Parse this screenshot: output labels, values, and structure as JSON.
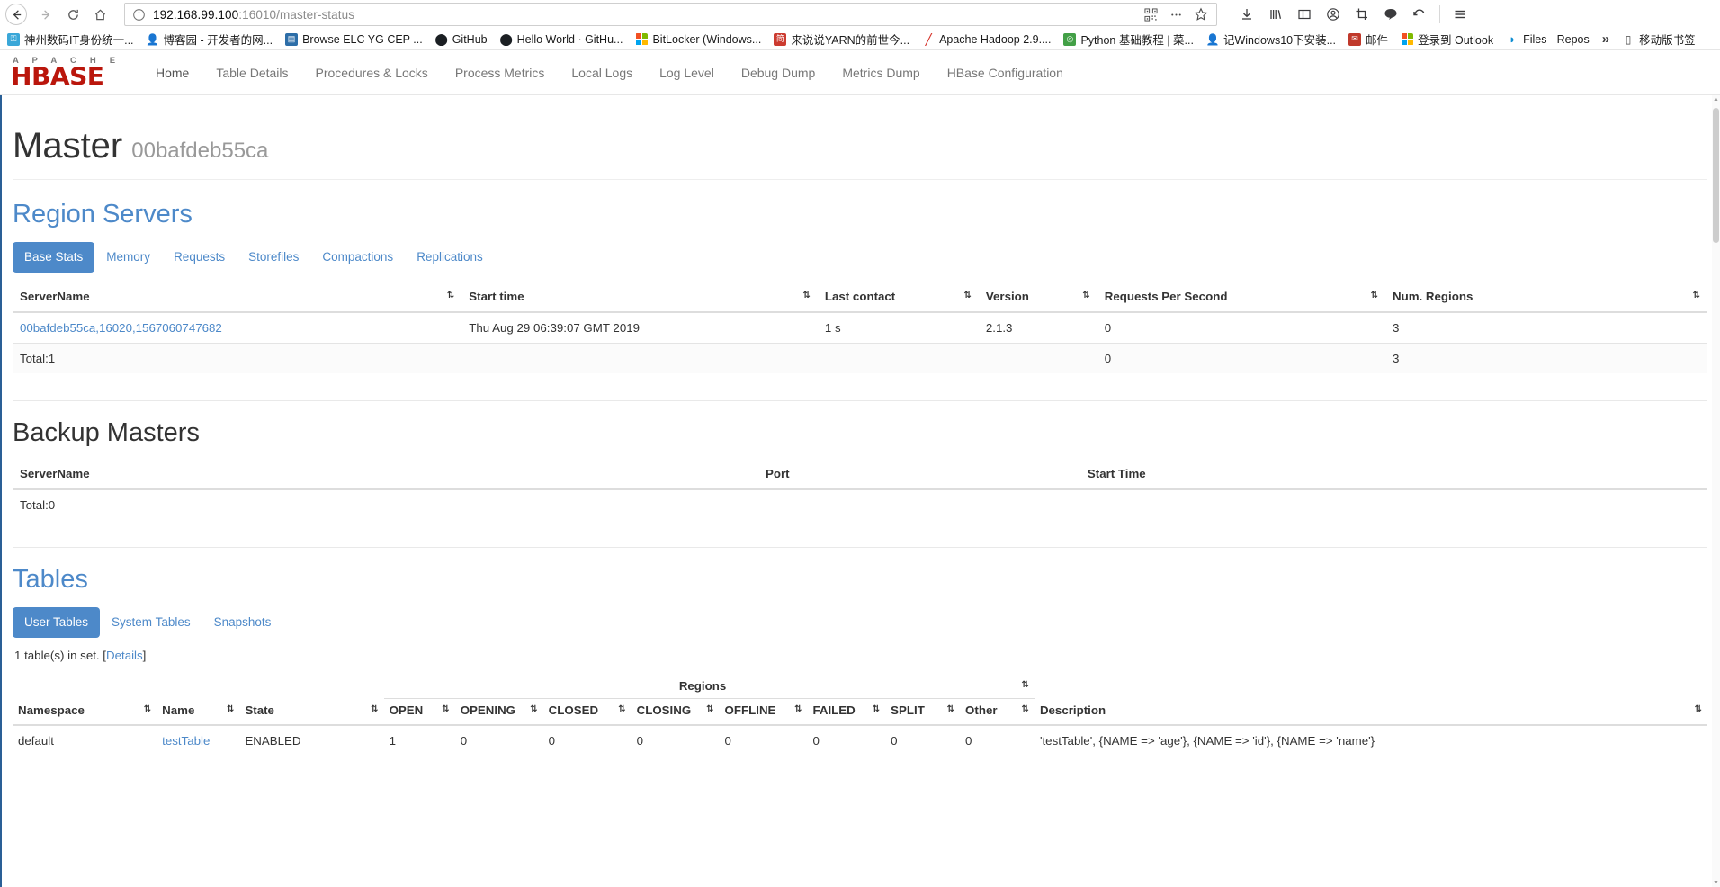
{
  "browser": {
    "url_host": "192.168.99.100",
    "url_rest": ":16010/master-status",
    "nav": {
      "back": "back-arrow",
      "forward": "forward-arrow",
      "reload": "reload",
      "home": "home"
    },
    "bookmarks": [
      {
        "label": "神州数码IT身份统一...",
        "icon": "key-icon",
        "style": "ic-key"
      },
      {
        "label": "博客园 - 开发者的网...",
        "icon": "person-icon",
        "style": "ic-person"
      },
      {
        "label": "Browse ELC YG CEP ...",
        "icon": "device-icon",
        "style": "ic-blue"
      },
      {
        "label": "GitHub",
        "icon": "github-icon",
        "style": "ic-github"
      },
      {
        "label": "Hello World · GitHu...",
        "icon": "github-icon",
        "style": "ic-github"
      },
      {
        "label": "BitLocker (Windows...",
        "icon": "microsoft-icon",
        "style": "ic-ms"
      },
      {
        "label": "来说说YARN的前世今...",
        "icon": "jian-icon",
        "style": "ic-red"
      },
      {
        "label": "Apache Hadoop 2.9....",
        "icon": "hadoop-icon",
        "style": "ic-hadoop"
      },
      {
        "label": "Python 基础教程 | 菜...",
        "icon": "python-icon",
        "style": "ic-py"
      },
      {
        "label": "记Windows10下安装...",
        "icon": "person-icon",
        "style": "ic-person"
      },
      {
        "label": "邮件",
        "icon": "mail-icon",
        "style": "ic-mail"
      },
      {
        "label": "登录到 Outlook",
        "icon": "microsoft-icon",
        "style": "ic-ms"
      },
      {
        "label": "Files - Repos",
        "icon": "files-icon",
        "style": "ic-files"
      }
    ],
    "bookmarks_overflow": "»",
    "mobile_bookmarks": {
      "label": "移动版书签",
      "icon": "mobile-icon",
      "style": "ic-mobile"
    },
    "toolbar_right_icons": [
      "download-icon",
      "library-icon",
      "sidebar-icon",
      "account-icon",
      "screenshot-icon",
      "pocket-icon",
      "sync-icon",
      "menu-icon"
    ],
    "urlbar_icons": [
      "qrcode-icon",
      "more-icon",
      "bookmark-star-icon"
    ]
  },
  "hbase_nav": {
    "logo_top": "A P A C H E",
    "logo_main": "HBASE",
    "items": [
      {
        "label": "Home",
        "active": true
      },
      {
        "label": "Table Details",
        "active": false
      },
      {
        "label": "Procedures & Locks",
        "active": false
      },
      {
        "label": "Process Metrics",
        "active": false
      },
      {
        "label": "Local Logs",
        "active": false
      },
      {
        "label": "Log Level",
        "active": false
      },
      {
        "label": "Debug Dump",
        "active": false
      },
      {
        "label": "Metrics Dump",
        "active": false
      },
      {
        "label": "HBase Configuration",
        "active": false
      }
    ]
  },
  "page": {
    "title": "Master",
    "subtitle": "00bafdeb55ca"
  },
  "region_servers": {
    "heading": "Region Servers",
    "tabs": [
      {
        "label": "Base Stats",
        "active": true
      },
      {
        "label": "Memory",
        "active": false
      },
      {
        "label": "Requests",
        "active": false
      },
      {
        "label": "Storefiles",
        "active": false
      },
      {
        "label": "Compactions",
        "active": false
      },
      {
        "label": "Replications",
        "active": false
      }
    ],
    "columns": [
      "ServerName",
      "Start time",
      "Last contact",
      "Version",
      "Requests Per Second",
      "Num. Regions"
    ],
    "rows": [
      {
        "server_name": "00bafdeb55ca,16020,1567060747682",
        "start_time": "Thu Aug 29 06:39:07 GMT 2019",
        "last_contact": "1 s",
        "version": "2.1.3",
        "requests_per_second": "0",
        "num_regions": "3"
      }
    ],
    "total": {
      "label": "Total:1",
      "requests_per_second": "0",
      "num_regions": "3"
    }
  },
  "backup_masters": {
    "heading": "Backup Masters",
    "columns": [
      "ServerName",
      "Port",
      "Start Time"
    ],
    "total_label": "Total:0"
  },
  "tables_section": {
    "heading": "Tables",
    "tabs": [
      {
        "label": "User Tables",
        "active": true
      },
      {
        "label": "System Tables",
        "active": false
      },
      {
        "label": "Snapshots",
        "active": false
      }
    ],
    "info_prefix": "1 table(s) in set. [",
    "info_link": "Details",
    "info_suffix": "]",
    "columns_level1": [
      "Namespace",
      "Name",
      "State"
    ],
    "regions_group_label": "Regions",
    "regions_columns": [
      "OPEN",
      "OPENING",
      "CLOSED",
      "CLOSING",
      "OFFLINE",
      "FAILED",
      "SPLIT",
      "Other"
    ],
    "description_label": "Description",
    "rows": [
      {
        "namespace": "default",
        "name": "testTable",
        "state": "ENABLED",
        "open": "1",
        "opening": "0",
        "closed": "0",
        "closing": "0",
        "offline": "0",
        "failed": "0",
        "split": "0",
        "other": "0",
        "description": "'testTable', {NAME => 'age'}, {NAME => 'id'}, {NAME => 'name'}"
      }
    ]
  },
  "sort_indicator": "⇅",
  "colors": {
    "accent_blue": "#4d89c9",
    "hbase_red": "#ba160c",
    "link_blue": "#4d89c9",
    "text": "#333333",
    "muted": "#999999"
  }
}
